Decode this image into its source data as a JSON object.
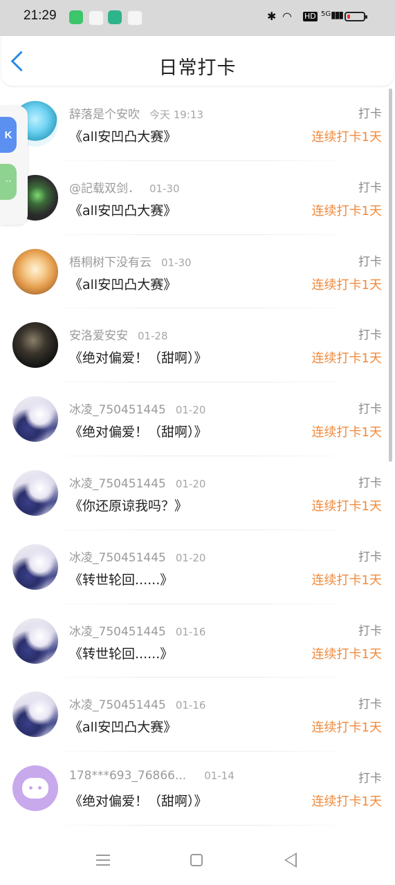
{
  "status_bar": {
    "time": "21:29",
    "app_icons": [
      "green-app-icon",
      "pink-app-icon",
      "teal-app-icon",
      "blue-app-icon"
    ],
    "network": "5G",
    "hd": "HD",
    "battery_level": 0.1
  },
  "header": {
    "title": "日常打卡",
    "back_icon": "chevron-left-icon"
  },
  "side_widget": {
    "k_label": "K",
    "g_label": "··"
  },
  "records": [
    {
      "name": "辞落是个安吹",
      "date": "今天 19:13",
      "content": "《all安凹凸大赛》",
      "tag": "打卡",
      "streak": "连续打卡1天"
    },
    {
      "name": "@記载双剑．",
      "date": "01-30",
      "content": "《all安凹凸大赛》",
      "tag": "打卡",
      "streak": "连续打卡1天"
    },
    {
      "name": "梧桐树下没有云",
      "date": "01-30",
      "content": "《all安凹凸大赛》",
      "tag": "打卡",
      "streak": "连续打卡1天"
    },
    {
      "name": "安洛爱安安",
      "date": "01-28",
      "content": "《绝对偏爱！（甜啊）》",
      "tag": "打卡",
      "streak": "连续打卡1天"
    },
    {
      "name": "冰凌_750451445",
      "date": "01-20",
      "content": "《绝对偏爱！（甜啊）》",
      "tag": "打卡",
      "streak": "连续打卡1天"
    },
    {
      "name": "冰凌_750451445",
      "date": "01-20",
      "content": "《你还原谅我吗？》",
      "tag": "打卡",
      "streak": "连续打卡1天"
    },
    {
      "name": "冰凌_750451445",
      "date": "01-20",
      "content": "《转世轮回......》",
      "tag": "打卡",
      "streak": "连续打卡1天"
    },
    {
      "name": "冰凌_750451445",
      "date": "01-16",
      "content": "《转世轮回......》",
      "tag": "打卡",
      "streak": "连续打卡1天"
    },
    {
      "name": "冰凌_750451445",
      "date": "01-16",
      "content": "《all安凹凸大赛》",
      "tag": "打卡",
      "streak": "连续打卡1天"
    },
    {
      "name": "178***693_76866...",
      "date": "01-14",
      "content": "《绝对偏爱！（甜啊）》",
      "tag": "打卡",
      "streak": "连续打卡1天"
    }
  ],
  "colors": {
    "accent": "#2b8be6",
    "streak": "#f08a3c",
    "meta": "#9a9a9a"
  }
}
